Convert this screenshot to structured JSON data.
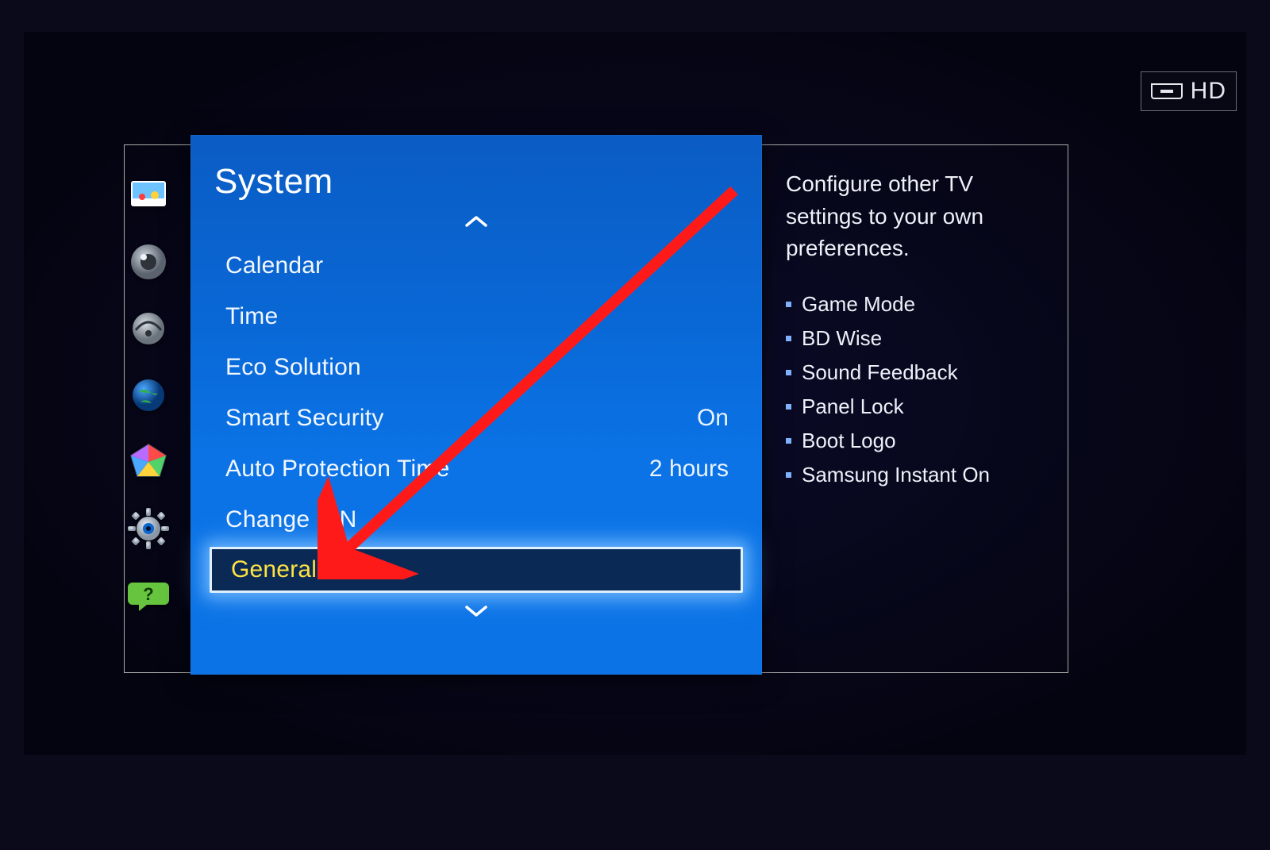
{
  "hdmi_label": "HD",
  "border": true,
  "sidebar": {
    "icons": [
      {
        "name": "picture-icon"
      },
      {
        "name": "speaker-icon"
      },
      {
        "name": "network-icon"
      },
      {
        "name": "globe-icon"
      },
      {
        "name": "smarthub-icon"
      },
      {
        "name": "settings-gear-icon"
      },
      {
        "name": "support-help-icon"
      }
    ]
  },
  "panel": {
    "title": "System",
    "items": [
      {
        "label": "Calendar",
        "value": ""
      },
      {
        "label": "Time",
        "value": ""
      },
      {
        "label": "Eco Solution",
        "value": ""
      },
      {
        "label": "Smart Security",
        "value": "On"
      },
      {
        "label": "Auto Protection Time",
        "value": "2 hours"
      },
      {
        "label": "Change PIN",
        "value": ""
      },
      {
        "label": "General",
        "value": "",
        "selected": true
      }
    ]
  },
  "help": {
    "description": "Configure other TV settings to your own preferences.",
    "bullets": [
      "Game Mode",
      "BD Wise",
      "Sound Feedback",
      "Panel Lock",
      "Boot Logo",
      "Samsung Instant On"
    ]
  }
}
